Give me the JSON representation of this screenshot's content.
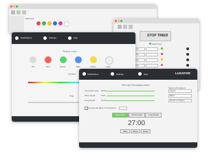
{
  "window_top_left": {
    "label_small": "Edit color",
    "swatches": [
      "#e94b4b",
      "#4caf50",
      "#f0c419",
      "#2b6fd6",
      "#e53bb0",
      "#ffffff"
    ]
  },
  "window_timer": {
    "stop_button": "STOP TIMER",
    "sub_label": "Select time",
    "rows": [
      {
        "label": "Color",
        "value": "Color",
        "color": "#37b24d"
      },
      {
        "label": "Color",
        "value": "Color",
        "color": "#e03131"
      },
      {
        "label": "Color",
        "value": "Color",
        "color": "#fab005"
      },
      {
        "label": "Color",
        "value": "Color",
        "color": "#e64980"
      },
      {
        "label": "Color",
        "value": "Color",
        "color": "#1c7ed6"
      },
      {
        "label": "Color",
        "value": "Color",
        "color": "#f59f00"
      }
    ]
  },
  "window_select_color": {
    "nav": [
      "Notifications",
      "Settings",
      "Help"
    ],
    "heading": "Select color",
    "swatches": [
      {
        "name": "Off",
        "color": "#d9d9d9"
      },
      {
        "name": "Red",
        "color": "#ff5a5a"
      },
      {
        "name": "Green",
        "color": "#59d36a"
      },
      {
        "name": "Blue",
        "color": "#4f8ff0"
      },
      {
        "name": "Yellow",
        "color": "#f6d93b"
      },
      {
        "name": "Light",
        "color": "#f0f0f0"
      }
    ],
    "sub_heading": "Select",
    "sub_heading2": "Pre"
  },
  "window_timer_set": {
    "nav": [
      "Notifications",
      "Settings",
      "Help"
    ],
    "logo": "LUXAFOR",
    "heading": "Set Up Pomodoro time",
    "rows": [
      {
        "label": "Pomodoro time",
        "value": "25:00"
      },
      {
        "label": "Short break",
        "value": "5:00"
      },
      {
        "label": "Long break",
        "value": "15:00"
      }
    ],
    "right_header": "Select with pattern",
    "right_options": [
      "Select",
      "Blink",
      "Random Pattern"
    ],
    "checkbox_label": "Long break after 4 Pomodoros",
    "mode_buttons": [
      "Pomodoro",
      "Short break",
      "Long break"
    ],
    "timer": "27:00",
    "action_buttons": [
      "Start",
      "Pause",
      "Reset"
    ]
  }
}
